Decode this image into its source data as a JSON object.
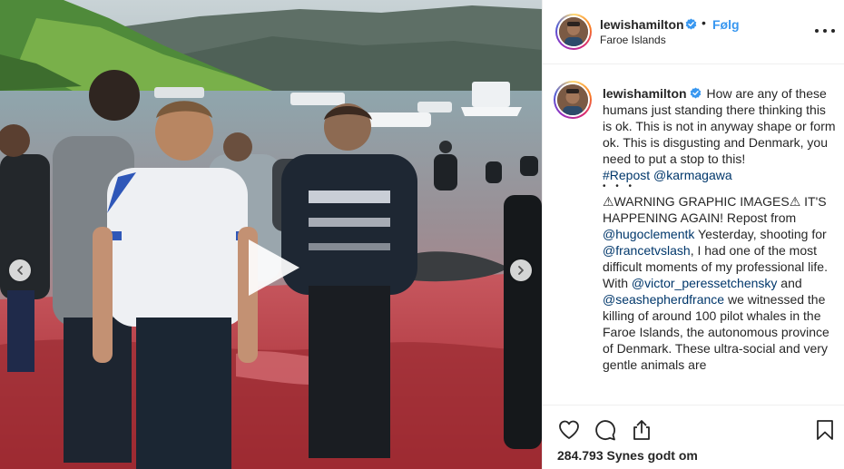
{
  "post": {
    "username": "lewishamilton",
    "follow_label": "Følg",
    "separator": "•",
    "location": "Faroe Islands",
    "more_icon": "more-horizontal-icon"
  },
  "caption": {
    "username": "lewishamilton",
    "text_1": "How are any of these humans just standing there thinking this is ok. This is not in anyway shape or form ok. This is disgusting and Denmark, you need to put a stop to this!",
    "hashtag": "#Repost",
    "mention_1": "@karmagawa",
    "dots": "• • •",
    "text_2": "⚠WARNING GRAPHIC IMAGES⚠ IT'S HAPPENING AGAIN! Repost from",
    "mention_2": "@hugoclementk",
    "text_3": "Yesterday, shooting for",
    "mention_3": "@francetvslash",
    "text_4": ", I had one of the most difficult moments of my professional life. With",
    "mention_4": "@victor_peressetchensky",
    "text_5": "and",
    "mention_5": "@seashepherdfrance",
    "text_6": "we witnessed the killing of around 100 pilot whales in the Faroe Islands, the autonomous province of Denmark. These ultra-social and very gentle animals are"
  },
  "media": {
    "type": "video",
    "play_icon": "play-icon",
    "prev_icon": "chevron-left-icon",
    "next_icon": "chevron-right-icon"
  },
  "actions": {
    "like_icon": "heart-icon",
    "comment_icon": "comment-icon",
    "share_icon": "share-icon",
    "save_icon": "bookmark-icon",
    "likes_text": "284.793 Synes godt om"
  },
  "colors": {
    "link": "#00376b",
    "follow": "#3897f0",
    "verified": "#3897f0",
    "text": "#262626"
  }
}
